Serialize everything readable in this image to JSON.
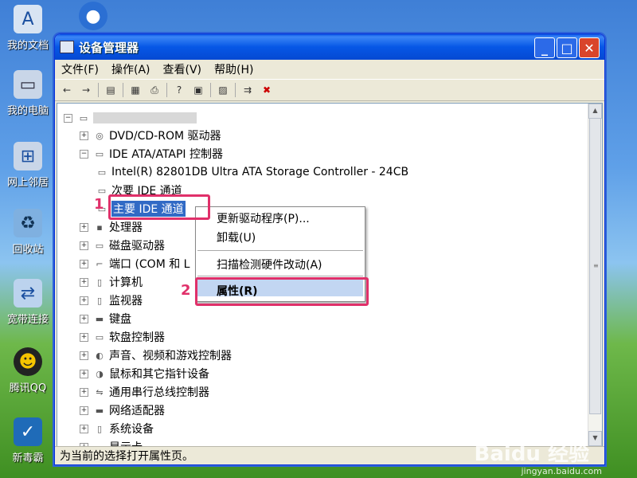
{
  "desktop": {
    "icons": [
      {
        "label": "我的文档",
        "icon": "documents-icon"
      },
      {
        "label": "我的电脑",
        "icon": "computer-icon"
      },
      {
        "label": "网上邻居",
        "icon": "network-icon"
      },
      {
        "label": "回收站",
        "icon": "recycle-bin-icon"
      },
      {
        "label": "宽带连接",
        "icon": "broadband-icon"
      },
      {
        "label": "腾讯QQ",
        "icon": "qq-icon"
      },
      {
        "label": "新毒霸",
        "icon": "antivirus-icon"
      }
    ]
  },
  "window": {
    "title": "设备管理器",
    "menu": [
      "文件(F)",
      "操作(A)",
      "查看(V)",
      "帮助(H)"
    ],
    "status": "为当前的选择打开属性页。"
  },
  "tree": {
    "items": [
      {
        "label": "DVD/CD-ROM 驱动器",
        "expander": "+"
      },
      {
        "label": "IDE ATA/ATAPI 控制器",
        "expander": "-"
      },
      {
        "label": "Intel(R) 82801DB Ultra ATA Storage Controller - 24CB",
        "expander": ""
      },
      {
        "label": "次要 IDE 通道",
        "expander": ""
      },
      {
        "label": "主要 IDE 通道",
        "expander": ""
      },
      {
        "label": "处理器",
        "expander": "+"
      },
      {
        "label": "磁盘驱动器",
        "expander": "+"
      },
      {
        "label": "端口 (COM 和 L",
        "expander": "+"
      },
      {
        "label": "计算机",
        "expander": "+"
      },
      {
        "label": "监视器",
        "expander": "+"
      },
      {
        "label": "键盘",
        "expander": "+"
      },
      {
        "label": "软盘控制器",
        "expander": "+"
      },
      {
        "label": "声音、视频和游戏控制器",
        "expander": "+"
      },
      {
        "label": "鼠标和其它指针设备",
        "expander": "+"
      },
      {
        "label": "通用串行总线控制器",
        "expander": "+"
      },
      {
        "label": "网络适配器",
        "expander": "+"
      },
      {
        "label": "系统设备",
        "expander": "+"
      },
      {
        "label": "显示卡",
        "expander": "+"
      }
    ]
  },
  "context_menu": {
    "items": [
      "更新驱动程序(P)...",
      "卸载(U)",
      "扫描检测硬件改动(A)",
      "属性(R)"
    ]
  },
  "annotations": {
    "marker1": "1",
    "marker2": "2",
    "accent": "#e0306a"
  },
  "watermark": {
    "brand": "Baidu 经验",
    "url": "jingyan.baidu.com"
  }
}
